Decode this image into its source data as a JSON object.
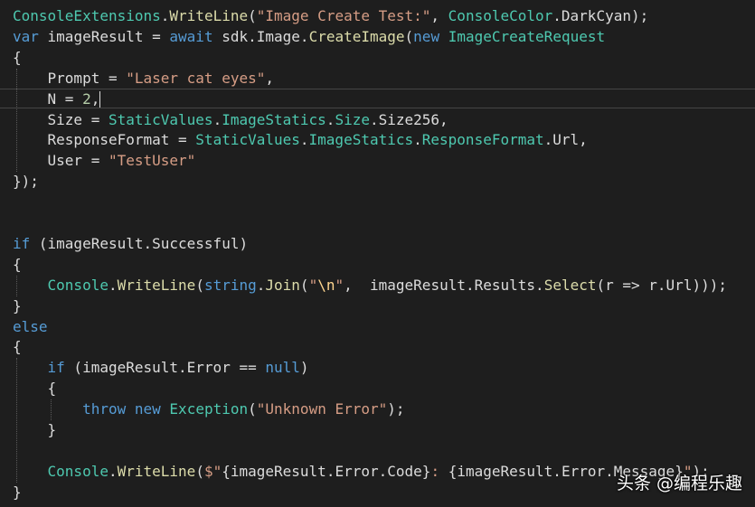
{
  "colors": {
    "background": "#1e1e1e",
    "plain": "#dcdcdc",
    "keyword": "#569cd6",
    "type": "#4ec9b0",
    "method": "#dcdcaa",
    "string": "#d69d85",
    "number": "#b5cea8",
    "escape": "#ffd68f"
  },
  "code_lines": [
    [
      [
        "ConsoleExtensions",
        "type"
      ],
      [
        ".",
        "plain"
      ],
      [
        "WriteLine",
        "method"
      ],
      [
        "(",
        "plain"
      ],
      [
        "\"Image Create Test:\"",
        "string"
      ],
      [
        ", ",
        "plain"
      ],
      [
        "ConsoleColor",
        "type"
      ],
      [
        ".",
        "plain"
      ],
      [
        "DarkCyan",
        "plain"
      ],
      [
        ");",
        "plain"
      ]
    ],
    [
      [
        "var",
        "keyword"
      ],
      [
        " imageResult = ",
        "plain"
      ],
      [
        "await",
        "keyword"
      ],
      [
        " sdk.",
        "plain"
      ],
      [
        "Image",
        "plain"
      ],
      [
        ".",
        "plain"
      ],
      [
        "CreateImage",
        "method"
      ],
      [
        "(",
        "plain"
      ],
      [
        "new",
        "keyword"
      ],
      [
        " ",
        "plain"
      ],
      [
        "ImageCreateRequest",
        "type"
      ]
    ],
    [
      [
        "{",
        "plain"
      ]
    ],
    [
      [
        "    Prompt = ",
        "plain"
      ],
      [
        "\"Laser cat eyes\"",
        "string"
      ],
      [
        ",",
        "plain"
      ]
    ],
    [
      [
        "    N = ",
        "plain"
      ],
      [
        "2",
        "number"
      ],
      [
        ",",
        "plain"
      ]
    ],
    [
      [
        "    Size = ",
        "plain"
      ],
      [
        "StaticValues",
        "type"
      ],
      [
        ".",
        "plain"
      ],
      [
        "ImageStatics",
        "type"
      ],
      [
        ".",
        "plain"
      ],
      [
        "Size",
        "type"
      ],
      [
        ".",
        "plain"
      ],
      [
        "Size256",
        "plain"
      ],
      [
        ",",
        "plain"
      ]
    ],
    [
      [
        "    ResponseFormat = ",
        "plain"
      ],
      [
        "StaticValues",
        "type"
      ],
      [
        ".",
        "plain"
      ],
      [
        "ImageStatics",
        "type"
      ],
      [
        ".",
        "plain"
      ],
      [
        "ResponseFormat",
        "type"
      ],
      [
        ".",
        "plain"
      ],
      [
        "Url",
        "plain"
      ],
      [
        ",",
        "plain"
      ]
    ],
    [
      [
        "    User = ",
        "plain"
      ],
      [
        "\"TestUser\"",
        "string"
      ]
    ],
    [
      [
        "});",
        "plain"
      ]
    ],
    [],
    [],
    [
      [
        "if",
        "keyword"
      ],
      [
        " (imageResult.",
        "plain"
      ],
      [
        "Successful",
        "plain"
      ],
      [
        ")",
        "plain"
      ]
    ],
    [
      [
        "{",
        "plain"
      ]
    ],
    [
      [
        "    ",
        "plain"
      ],
      [
        "Console",
        "type"
      ],
      [
        ".",
        "plain"
      ],
      [
        "WriteLine",
        "method"
      ],
      [
        "(",
        "plain"
      ],
      [
        "string",
        "keyword"
      ],
      [
        ".",
        "plain"
      ],
      [
        "Join",
        "method"
      ],
      [
        "(",
        "plain"
      ],
      [
        "\"",
        "string"
      ],
      [
        "\\n",
        "escape"
      ],
      [
        "\"",
        "string"
      ],
      [
        ",  imageResult.",
        "plain"
      ],
      [
        "Results",
        "plain"
      ],
      [
        ".",
        "plain"
      ],
      [
        "Select",
        "method"
      ],
      [
        "(r => r.",
        "plain"
      ],
      [
        "Url",
        "plain"
      ],
      [
        ")));",
        "plain"
      ]
    ],
    [
      [
        "}",
        "plain"
      ]
    ],
    [
      [
        "else",
        "keyword"
      ]
    ],
    [
      [
        "{",
        "plain"
      ]
    ],
    [
      [
        "    ",
        "plain"
      ],
      [
        "if",
        "keyword"
      ],
      [
        " (imageResult.",
        "plain"
      ],
      [
        "Error",
        "plain"
      ],
      [
        " == ",
        "plain"
      ],
      [
        "null",
        "keyword"
      ],
      [
        ")",
        "plain"
      ]
    ],
    [
      [
        "    {",
        "plain"
      ]
    ],
    [
      [
        "        ",
        "plain"
      ],
      [
        "throw",
        "keyword"
      ],
      [
        " ",
        "plain"
      ],
      [
        "new",
        "keyword"
      ],
      [
        " ",
        "plain"
      ],
      [
        "Exception",
        "type"
      ],
      [
        "(",
        "plain"
      ],
      [
        "\"Unknown Error\"",
        "string"
      ],
      [
        ");",
        "plain"
      ]
    ],
    [
      [
        "    }",
        "plain"
      ]
    ],
    [],
    [
      [
        "    ",
        "plain"
      ],
      [
        "Console",
        "type"
      ],
      [
        ".",
        "plain"
      ],
      [
        "WriteLine",
        "method"
      ],
      [
        "(",
        "plain"
      ],
      [
        "$\"",
        "string"
      ],
      [
        "{imageResult.",
        "plain"
      ],
      [
        "Error",
        "plain"
      ],
      [
        ".",
        "plain"
      ],
      [
        "Code",
        "plain"
      ],
      [
        "}",
        "plain"
      ],
      [
        ": ",
        "string"
      ],
      [
        "{imageResult.",
        "plain"
      ],
      [
        "Error",
        "plain"
      ],
      [
        ".",
        "plain"
      ],
      [
        "Message",
        "plain"
      ],
      [
        "}",
        "plain"
      ],
      [
        "\"",
        "string"
      ],
      [
        ");",
        "plain"
      ]
    ],
    [
      [
        "}",
        "plain"
      ]
    ]
  ],
  "watermark": "头条 @编程乐趣"
}
